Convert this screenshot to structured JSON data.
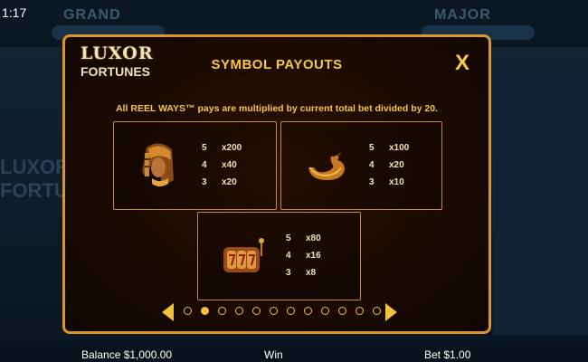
{
  "status": {
    "clock": "1:17"
  },
  "background": {
    "jackpot_left": "GRAND",
    "jackpot_right": "MAJOR",
    "logo_line1": "LUXOR",
    "logo_line2": "FORTUNES"
  },
  "modal": {
    "logo_line1": "LUXOR",
    "logo_line2": "FORTUNES",
    "title": "SYMBOL PAYOUTS",
    "close_label": "X",
    "description": "All REEL WAYS™ pays are multiplied by current total bet divided by 20.",
    "symbols": [
      {
        "icon": "pharaoh-queen-icon",
        "payouts": [
          {
            "count": "5",
            "mult": "x200"
          },
          {
            "count": "4",
            "mult": "x40"
          },
          {
            "count": "3",
            "mult": "x20"
          }
        ]
      },
      {
        "icon": "golden-snake-icon",
        "payouts": [
          {
            "count": "5",
            "mult": "x100"
          },
          {
            "count": "4",
            "mult": "x20"
          },
          {
            "count": "3",
            "mult": "x10"
          }
        ]
      },
      {
        "icon": "slot-machine-777-icon",
        "payouts": [
          {
            "count": "5",
            "mult": "x80"
          },
          {
            "count": "4",
            "mult": "x16"
          },
          {
            "count": "3",
            "mult": "x8"
          }
        ]
      }
    ],
    "pager": {
      "page_count": 12,
      "active_page": 2
    }
  },
  "footer": {
    "balance": "Balance $1,000.00",
    "win": "Win",
    "bet": "Bet $1.00"
  },
  "colors": {
    "accent": "#f7c64a",
    "border": "#d9952a",
    "panel_bg": "#1a0a02"
  }
}
